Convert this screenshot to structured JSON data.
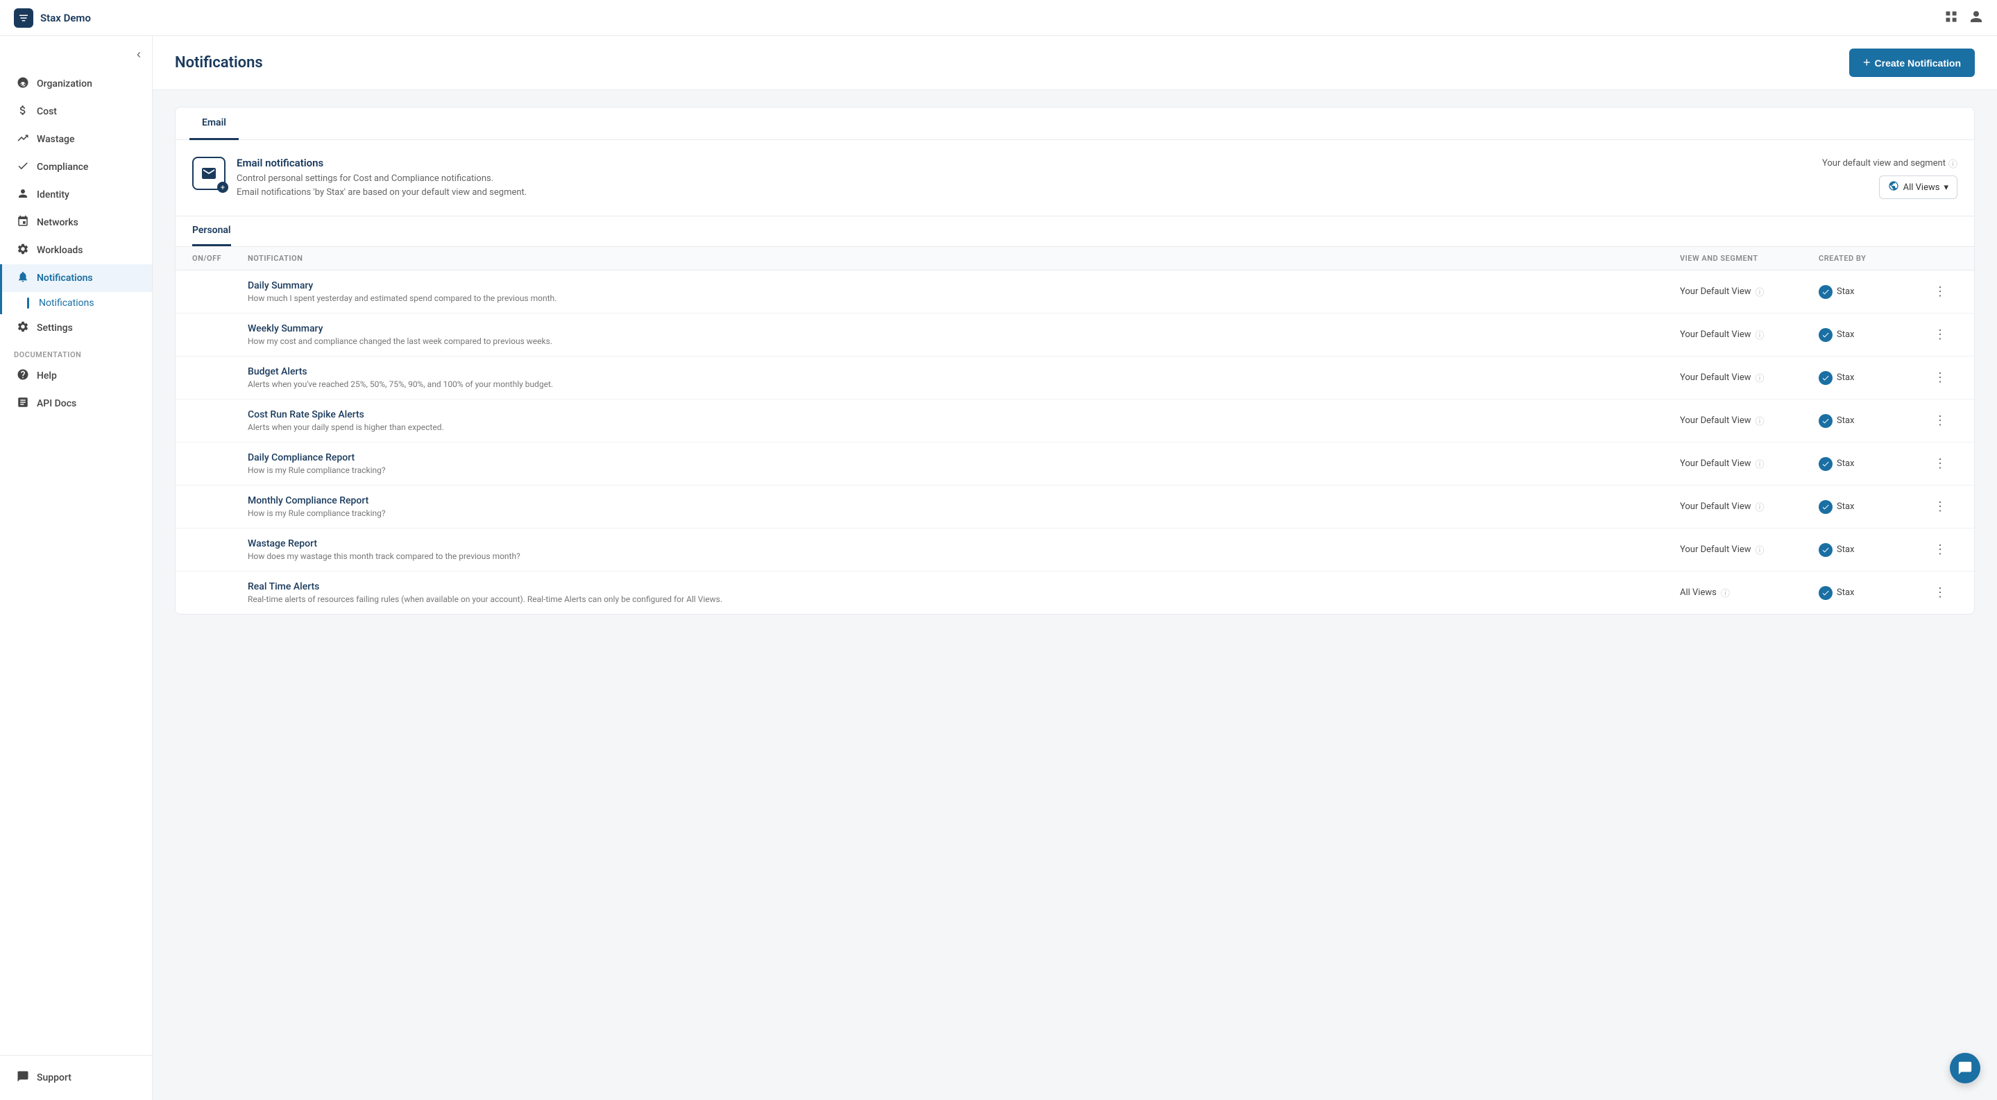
{
  "app": {
    "title": "Stax Demo"
  },
  "topbar": {
    "title": "Stax Demo",
    "grid_icon": "grid-icon",
    "user_icon": "user-icon"
  },
  "sidebar": {
    "toggle_label": "←",
    "items": [
      {
        "id": "organization",
        "label": "Organization",
        "icon": "🏢"
      },
      {
        "id": "cost",
        "label": "Cost",
        "icon": "💰"
      },
      {
        "id": "wastage",
        "label": "Wastage",
        "icon": "📉"
      },
      {
        "id": "compliance",
        "label": "Compliance",
        "icon": "📋"
      },
      {
        "id": "identity",
        "label": "Identity",
        "icon": "👤"
      },
      {
        "id": "networks",
        "label": "Networks",
        "icon": "🔗"
      },
      {
        "id": "workloads",
        "label": "Workloads",
        "icon": "⚙️"
      },
      {
        "id": "notifications",
        "label": "Notifications",
        "icon": "🔔",
        "active": true
      }
    ],
    "sub_items": [
      {
        "id": "notifications-sub",
        "label": "Notifications",
        "active": true
      }
    ],
    "settings": {
      "label": "Settings",
      "icon": "⚙️"
    },
    "documentation_label": "DOCUMENTATION",
    "doc_items": [
      {
        "id": "help",
        "label": "Help",
        "icon": "❓"
      },
      {
        "id": "api-docs",
        "label": "API Docs",
        "icon": "📖"
      }
    ],
    "bottom_items": [
      {
        "id": "support",
        "label": "Support",
        "icon": "💬"
      }
    ]
  },
  "page": {
    "title": "Notifications",
    "create_button": "Create Notification"
  },
  "tabs": [
    {
      "id": "email",
      "label": "Email",
      "active": true
    }
  ],
  "email_section": {
    "heading": "Email notifications",
    "description_line1": "Control personal settings for Cost and Compliance notifications.",
    "description_line2": "Email notifications 'by Stax' are based on your default view and segment.",
    "view_label": "Your default view and segment",
    "view_selector_label": "All Views"
  },
  "personal_tab": {
    "label": "Personal"
  },
  "table": {
    "columns": [
      {
        "key": "onoff",
        "label": "ON/OFF"
      },
      {
        "key": "notification",
        "label": "NOTIFICATION"
      },
      {
        "key": "view_segment",
        "label": "VIEW AND SEGMENT"
      },
      {
        "key": "created_by",
        "label": "CREATED BY"
      },
      {
        "key": "actions",
        "label": ""
      }
    ],
    "rows": [
      {
        "id": "daily-summary",
        "toggle": "on-dark",
        "name": "Daily Summary",
        "description": "How much I spent yesterday and estimated spend compared to the previous month.",
        "view_segment": "Your Default View",
        "created_by": "Stax"
      },
      {
        "id": "weekly-summary",
        "toggle": "on",
        "name": "Weekly Summary",
        "description": "How my cost and compliance changed the last week compared to previous weeks.",
        "view_segment": "Your Default View",
        "created_by": "Stax"
      },
      {
        "id": "budget-alerts",
        "toggle": "on-dark",
        "name": "Budget Alerts",
        "description": "Alerts when you've reached 25%, 50%, 75%, 90%, and 100% of your monthly budget.",
        "view_segment": "Your Default View",
        "created_by": "Stax"
      },
      {
        "id": "cost-run-rate",
        "toggle": "on-dark",
        "name": "Cost Run Rate Spike Alerts",
        "description": "Alerts when your daily spend is higher than expected.",
        "view_segment": "Your Default View",
        "created_by": "Stax"
      },
      {
        "id": "daily-compliance",
        "toggle": "off",
        "name": "Daily Compliance Report",
        "description": "How is my Rule compliance tracking?",
        "view_segment": "Your Default View",
        "created_by": "Stax"
      },
      {
        "id": "monthly-compliance",
        "toggle": "on-dark",
        "name": "Monthly Compliance Report",
        "description": "How is my Rule compliance tracking?",
        "view_segment": "Your Default View",
        "created_by": "Stax"
      },
      {
        "id": "wastage-report",
        "toggle": "on-dark",
        "name": "Wastage Report",
        "description": "How does my wastage this month track compared to the previous month?",
        "view_segment": "Your Default View",
        "created_by": "Stax"
      },
      {
        "id": "real-time-alerts",
        "toggle": "off",
        "name": "Real Time Alerts",
        "description": "Real-time alerts of resources failing rules (when available on your account). Real-time Alerts can only be configured for All Views.",
        "view_segment": "All Views",
        "created_by": "Stax"
      }
    ]
  }
}
